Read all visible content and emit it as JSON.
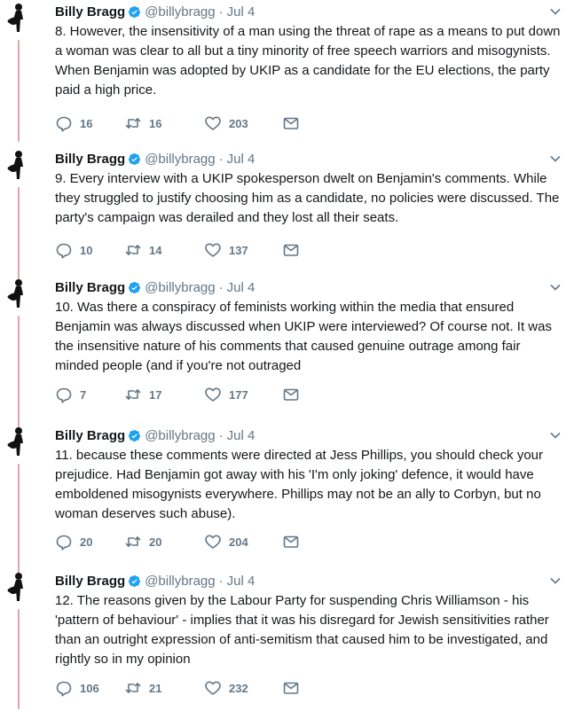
{
  "colors": {
    "text": "#14171a",
    "secondary": "#657786",
    "verified": "#1da1f2",
    "thread_line": "#e3a3a9"
  },
  "icons": {
    "reply": "reply-icon",
    "retweet": "retweet-icon",
    "like": "like-icon",
    "dm": "direct-message-icon",
    "more": "chevron-down-icon",
    "verified": "verified-badge-icon"
  },
  "tweets": [
    {
      "name": "Billy Bragg",
      "handle": "@billybragg",
      "sep": "·",
      "date": "Jul 4",
      "text": "8. However, the insensitivity of a man using the threat of rape as a means to put down a woman was clear to all but a tiny minority of free speech warriors and misogynists. When Benjamin was adopted by UKIP as a candidate for the EU elections, the party paid a high price.",
      "replies": "16",
      "retweets": "16",
      "likes": "203"
    },
    {
      "name": "Billy Bragg",
      "handle": "@billybragg",
      "sep": "·",
      "date": "Jul 4",
      "text": "9. Every interview with a UKIP spokesperson dwelt on Benjamin's comments. While they struggled to justify choosing him as a candidate, no policies were discussed. The party's campaign was derailed and they lost all their seats.",
      "replies": "10",
      "retweets": "14",
      "likes": "137"
    },
    {
      "name": "Billy Bragg",
      "handle": "@billybragg",
      "sep": "·",
      "date": "Jul 4",
      "text": "10. Was there a conspiracy of feminists working within the media that ensured Benjamin was always discussed when UKIP were interviewed? Of course not. It was the insensitive nature of his comments that caused genuine outrage among fair minded people (and if you're not outraged",
      "replies": "7",
      "retweets": "17",
      "likes": "177"
    },
    {
      "name": "Billy Bragg",
      "handle": "@billybragg",
      "sep": "·",
      "date": "Jul 4",
      "text": "11. because these comments were directed at Jess Phillips, you should check your prejudice. Had Benjamin got away with his 'I'm only joking' defence, it would have emboldened misogynists everywhere. Phillips may not be an ally to Corbyn, but no woman deserves such abuse).",
      "replies": "20",
      "retweets": "20",
      "likes": "204"
    },
    {
      "name": "Billy Bragg",
      "handle": "@billybragg",
      "sep": "·",
      "date": "Jul 4",
      "text": "12. The reasons given by the Labour Party for suspending Chris Williamson - his 'pattern of behaviour' - implies that it was his disregard for Jewish sensitivities rather than an outright expression of anti-semitism that caused him to be investigated, and rightly so in my opinion",
      "replies": "106",
      "retweets": "21",
      "likes": "232"
    }
  ]
}
